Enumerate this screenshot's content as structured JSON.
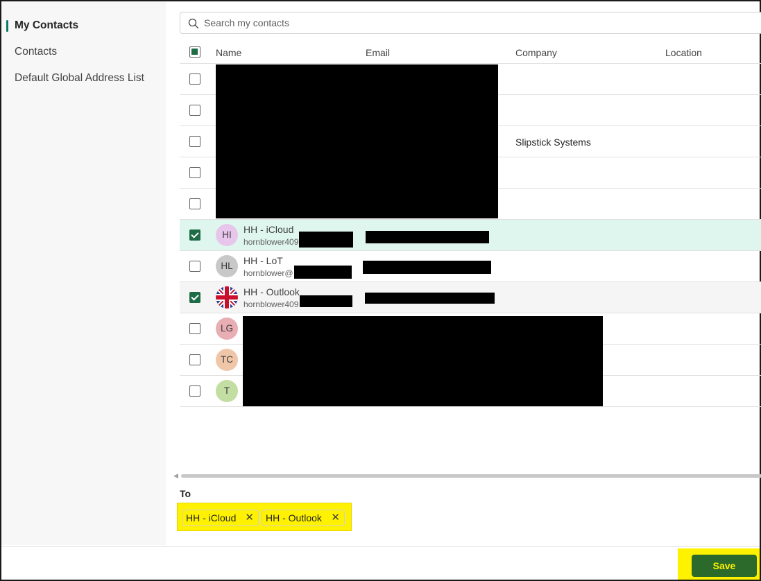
{
  "sidebar": {
    "items": [
      {
        "label": "My Contacts",
        "active": true
      },
      {
        "label": "Contacts",
        "active": false
      },
      {
        "label": "Default Global Address List",
        "active": false
      }
    ]
  },
  "search": {
    "placeholder": "Search my contacts",
    "icon": "search-icon"
  },
  "table": {
    "columns": [
      "Name",
      "Email",
      "Company",
      "Location"
    ],
    "header_checkbox": "partial",
    "rows": [
      {
        "checked": false,
        "name": "",
        "email_preview": "",
        "company": "",
        "redacted": true
      },
      {
        "checked": false,
        "name": "",
        "email_preview": "",
        "company": "",
        "redacted": true
      },
      {
        "checked": false,
        "name": "",
        "email_preview": "",
        "company": "Slipstick Systems",
        "redacted": true
      },
      {
        "checked": false,
        "name": "",
        "email_preview": "",
        "company": "",
        "redacted": true
      },
      {
        "checked": false,
        "name": "",
        "email_preview": "",
        "company": "",
        "redacted": true
      },
      {
        "checked": true,
        "initials": "HI",
        "avatar_color": "#e8c6ec",
        "name": "HH - iCloud",
        "email_preview": "hornblower409",
        "company": ""
      },
      {
        "checked": false,
        "initials": "HL",
        "avatar_color": "#c8c8c8",
        "name": "HH - LoT",
        "email_preview": "hornblower@",
        "company": ""
      },
      {
        "checked": true,
        "initials": "",
        "avatar_icon": "uk-flag-icon",
        "name": "HH - Outlook",
        "email_preview": "hornblower409",
        "company": ""
      },
      {
        "checked": false,
        "initials": "LG",
        "avatar_color": "#e8aeb4",
        "name": "",
        "email_preview": "",
        "company": ""
      },
      {
        "checked": false,
        "initials": "TC",
        "avatar_color": "#f0c6a8",
        "name": "",
        "email_preview": "",
        "company": ""
      },
      {
        "checked": false,
        "initials": "T",
        "avatar_color": "#c2dea2",
        "name": "",
        "email_preview": "",
        "company": ""
      }
    ]
  },
  "to": {
    "label": "To",
    "recipients": [
      "HH - iCloud",
      "HH - Outlook"
    ]
  },
  "footer": {
    "save_label": "Save"
  },
  "colors": {
    "accent": "#117865",
    "checkbox": "#1e6b46",
    "highlight": "#fff200",
    "save_button": "#2b6a2b"
  }
}
